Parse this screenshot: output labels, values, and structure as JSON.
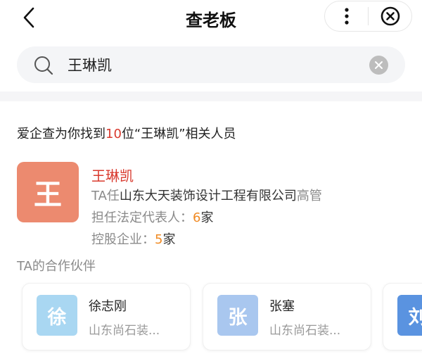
{
  "header": {
    "title": "查老板",
    "back_icon": "chevron-left-icon",
    "more_icon": "more-vertical-icon",
    "close_icon": "close-circle-icon"
  },
  "search": {
    "value": "王琳凯",
    "search_icon": "search-icon",
    "clear_icon": "clear-icon"
  },
  "result": {
    "prefix": "爱企查为你找到",
    "count": "10",
    "suffix": "位“王琳凯”相关人员"
  },
  "person": {
    "avatar_char": "王",
    "avatar_color": "#ec8a6f",
    "name": "王琳凯",
    "role_prefix": "TA任",
    "company": "山东大天装饰设计工程有限公司",
    "role_suffix": "高管",
    "legal_rep_label": "担任法定代表人：",
    "legal_rep_count": "6",
    "legal_rep_unit": "家",
    "holding_label": "控股企业：",
    "holding_count": "5",
    "holding_unit": "家"
  },
  "partners": {
    "title": "TA的合作伙伴",
    "items": [
      {
        "avatar_char": "徐",
        "name": "徐志刚",
        "company": "山东尚石装...",
        "color": "#a9d7f2"
      },
      {
        "avatar_char": "张",
        "name": "张塞",
        "company": "山东尚石装...",
        "color": "#a9c7ef"
      },
      {
        "avatar_char": "刘",
        "name": "",
        "company": "",
        "color": "#5a93e0"
      }
    ]
  },
  "colors": {
    "accent_red": "#d93a2e",
    "number_orange": "#f08a23"
  }
}
